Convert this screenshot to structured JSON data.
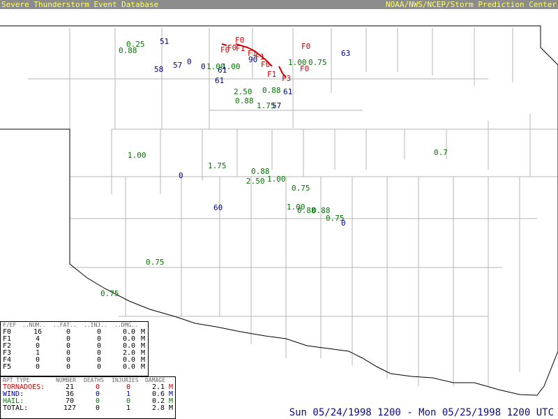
{
  "header": {
    "left_title": "Severe Thunderstorm Event Database",
    "right_title": "NOAA/NWS/NCEP/Storm Prediction Center"
  },
  "colors": {
    "header_bg": "#8c8c8c",
    "header_text": "#ffff66",
    "tornado": "#cc0000",
    "wind": "#000088",
    "hail": "#007700",
    "county_lines": "#b4b4b4",
    "state_border": "#000000"
  },
  "map": {
    "region": "Oklahoma",
    "hail_reports": [
      "0.25",
      "0.88",
      "1.00",
      "1.00",
      "2.50",
      "0.88",
      "0.88",
      "1.75",
      "1.00",
      "0.75",
      "1.00",
      "1.75",
      "0.88",
      "2.50",
      "1.00",
      "0.75",
      "1.00",
      "0.88",
      "0.88",
      "0.75",
      "0.75",
      "0.75",
      "0.7"
    ],
    "wind_reports": [
      "51",
      "58",
      "57",
      "0",
      "0",
      "61",
      "61",
      "90",
      "63",
      "61",
      "57",
      "0",
      "60",
      "0"
    ],
    "tornado_reports": [
      "F0",
      "F0",
      "F0",
      "F1",
      "F1",
      "F1",
      "F0",
      "F1",
      "F3",
      "F0",
      "F0"
    ]
  },
  "fscale_table": {
    "headers": [
      "F/EF",
      "..NUM..",
      "..FAT..",
      "..INJ..",
      "..DMG..",
      ""
    ],
    "rows": [
      {
        "scale": "F0",
        "num": "16",
        "fat": "0",
        "inj": "0",
        "dmg": "0.0",
        "unit": "M"
      },
      {
        "scale": "F1",
        "num": "4",
        "fat": "0",
        "inj": "0",
        "dmg": "0.0",
        "unit": "M"
      },
      {
        "scale": "F2",
        "num": "0",
        "fat": "0",
        "inj": "0",
        "dmg": "0.0",
        "unit": "M"
      },
      {
        "scale": "F3",
        "num": "1",
        "fat": "0",
        "inj": "0",
        "dmg": "2.0",
        "unit": "M"
      },
      {
        "scale": "F4",
        "num": "0",
        "fat": "0",
        "inj": "0",
        "dmg": "0.0",
        "unit": "M"
      },
      {
        "scale": "F5",
        "num": "0",
        "fat": "0",
        "inj": "0",
        "dmg": "0.0",
        "unit": "M"
      }
    ]
  },
  "totals_table": {
    "headers": [
      "RPT TYPE",
      "NUMBER",
      "DEATHS",
      "INJURIES",
      "DAMAGE",
      ""
    ],
    "rows": [
      {
        "type": "TORNADOES:",
        "number": "21",
        "deaths": "0",
        "injuries": "0",
        "damage": "2.1",
        "unit": "M",
        "color": "#cc0000"
      },
      {
        "type": "WIND:",
        "number": "36",
        "deaths": "0",
        "injuries": "1",
        "damage": "0.6",
        "unit": "M",
        "color": "#000088"
      },
      {
        "type": "HAIL:",
        "number": "70",
        "deaths": "0",
        "injuries": "0",
        "damage": "0.2",
        "unit": "M",
        "color": "#007700"
      },
      {
        "type": "TOTAL:",
        "number": "127",
        "deaths": "0",
        "injuries": "1",
        "damage": "2.8",
        "unit": "M",
        "color": "#000000"
      }
    ]
  },
  "date_range": "Sun 05/24/1998 1200 - Mon 05/25/1998 1200 UTC"
}
